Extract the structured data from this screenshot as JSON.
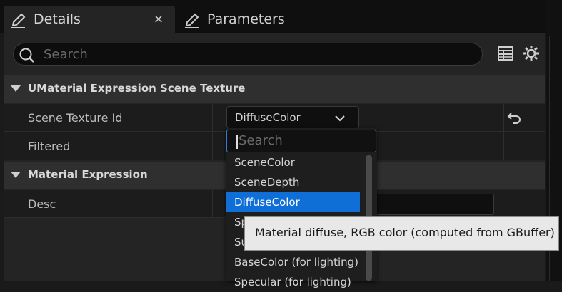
{
  "tabs": [
    {
      "label": "Details",
      "icon": "pencil-icon",
      "active": true,
      "close": "×"
    },
    {
      "label": "Parameters",
      "icon": "pencil-icon",
      "active": false
    }
  ],
  "search": {
    "placeholder": "Search"
  },
  "categories": [
    {
      "label": "UMaterial Expression Scene Texture"
    },
    {
      "label": "Material Expression"
    }
  ],
  "rows": {
    "scene_texture_id": {
      "label": "Scene Texture Id",
      "value": "DiffuseColor"
    },
    "filtered": {
      "label": "Filtered"
    },
    "desc": {
      "label": "Desc",
      "value": ""
    }
  },
  "dropdown": {
    "search_placeholder": "Search",
    "items": [
      {
        "label": "SceneColor"
      },
      {
        "label": "SceneDepth"
      },
      {
        "label": "DiffuseColor",
        "selected": true
      },
      {
        "label": "Sp"
      },
      {
        "label": "Su"
      },
      {
        "label": "BaseColor (for lighting)"
      },
      {
        "label": "Specular (for lighting)"
      }
    ]
  },
  "tooltip": {
    "text": "Material diffuse, RGB color (computed from GBuffer)"
  },
  "colors": {
    "accent": "#0f6fd6",
    "focus_border": "#2f7bd6",
    "panel": "#242424"
  }
}
